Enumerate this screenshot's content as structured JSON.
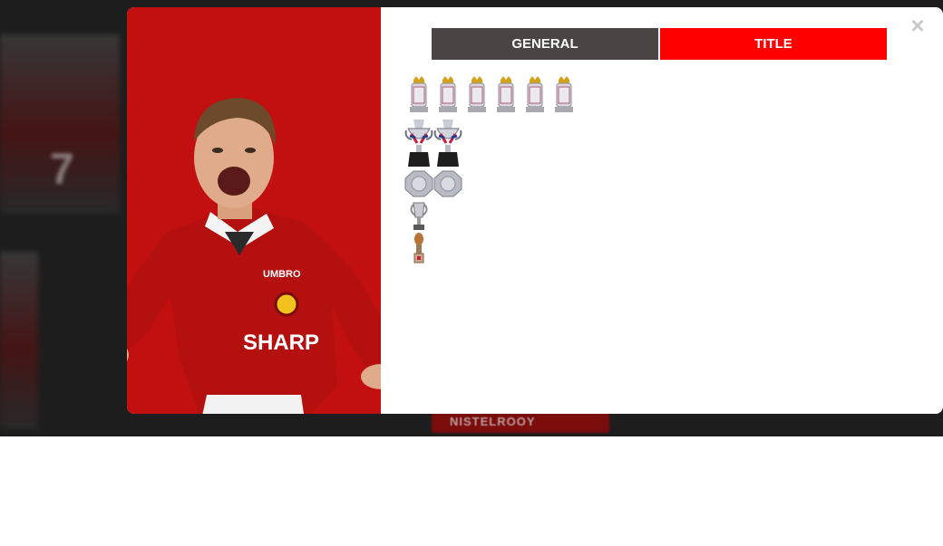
{
  "background": {
    "plate_label": "NISTELROOY"
  },
  "modal": {
    "close_label": "×",
    "tabs": [
      {
        "label": "GENERAL",
        "active": false
      },
      {
        "label": "TITLE",
        "active": true
      }
    ],
    "player": {
      "shirt_brand": "UMBRO",
      "shirt_sponsor": "SHARP"
    },
    "trophies": [
      {
        "icon": "premier-league-trophy-icon",
        "count": 6
      },
      {
        "icon": "fa-cup-trophy-icon",
        "count": 2
      },
      {
        "icon": "community-shield-icon",
        "count": 2
      },
      {
        "icon": "champions-league-trophy-icon",
        "count": 1
      },
      {
        "icon": "club-world-cup-trophy-icon",
        "count": 1
      }
    ]
  },
  "colors": {
    "accent": "#ff0000",
    "panel_red": "#c20f0f",
    "tab_inactive": "#4a4444"
  }
}
